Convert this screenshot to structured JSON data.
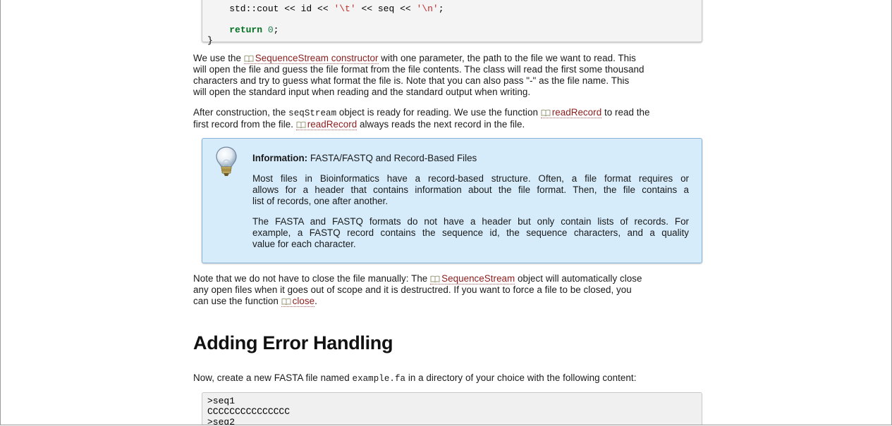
{
  "code_top": {
    "line1": {
      "a": "    std::cout << id << ",
      "s1": "'\\t'",
      "b": " << seq << ",
      "s2": "'\\n'",
      "c": ";"
    },
    "line2": {
      "indent": "    ",
      "kw": "return",
      "sp": " ",
      "num": "0",
      "end": ";"
    },
    "line3": "}"
  },
  "para1": {
    "l1a": "We use the ",
    "l1link": "SequenceStream constructor",
    "l1b": " with one parameter, the path to the file we want to read. This",
    "l2": "will open the file and guess the file format from the file contents. The class will read the first some thousand",
    "l3": "characters and try to guess what format the file is. Note that you can also pass \"-\" as the file name. This",
    "l4": "will open the standard input when reading and the standard output when writing."
  },
  "para2": {
    "l1a": "After construction, the ",
    "l1code": "seqStream",
    "l1b": " object is ready for reading. We use the function ",
    "l1link": "readRecord",
    "l1c": " to read the",
    "l2a": "first record from the file. ",
    "l2link": "readRecord",
    "l2b": " always reads the next record in the file."
  },
  "info": {
    "title_bold": "Information:",
    "title_rest": " FASTA/FASTQ and Record-Based Files",
    "p1": [
      "Most files in Bioinformatics have a record-based structure. Often, a file format requires or",
      "allows for a header that contains information about the file format. Then, the file contains a",
      "list of records, one after another."
    ],
    "p2": [
      "The FASTA and FASTQ formats do not have a header but only contain lists of records. For",
      "example, a FASTQ record contains the sequence id, the sequence characters, and a quality",
      "value for each character."
    ]
  },
  "para3": {
    "l1a": "Note that we do not have to close the file manually: The ",
    "l1link": "SequenceStream",
    "l1b": " object will automatically close",
    "l2": "any open files when it goes out of scope and it is destructred. If you want to force a file to be closed, you",
    "l3a": "can use the function ",
    "l3link": "close",
    "l3b": "."
  },
  "heading": "Adding Error Handling",
  "para4": {
    "a": "Now, create a new FASTA file named ",
    "code": "example.fa",
    "b": " in a directory of your choice with the following content:"
  },
  "code_bottom": [
    ">seq1",
    "CCCCCCCCCCCCCCC",
    ">seq2"
  ],
  "colors": {
    "link": "#8b1c1c",
    "info_bg": "#d6ecfb",
    "info_border": "#86b4d8",
    "keyword": "#007020",
    "string": "#c42b2b"
  }
}
